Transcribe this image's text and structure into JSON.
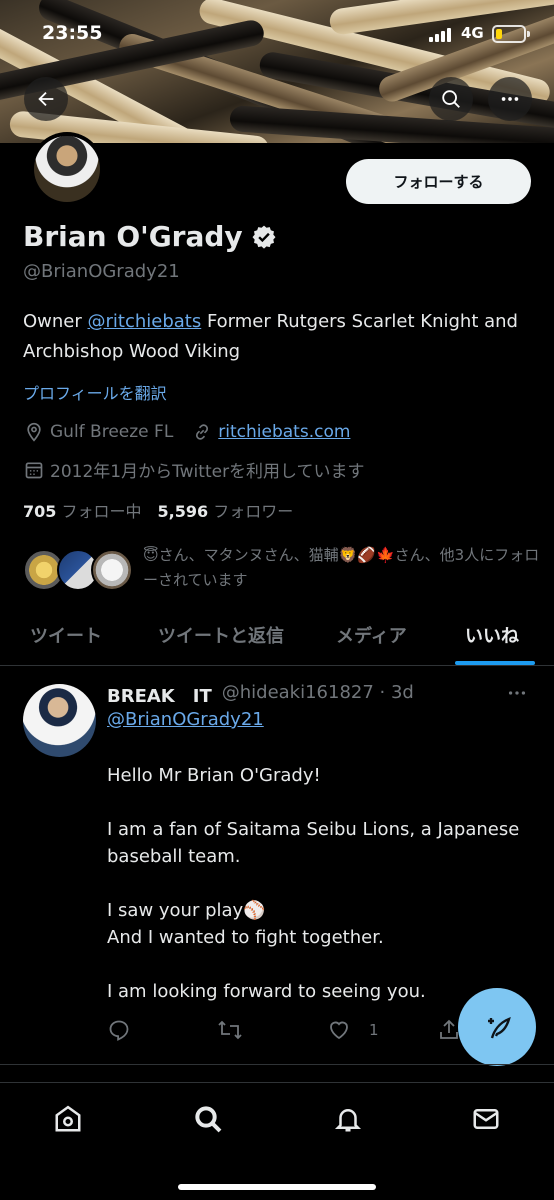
{
  "status_bar": {
    "time": "23:55",
    "network": "4G"
  },
  "header": {
    "back_icon": "arrow-left-icon",
    "search_icon": "search-icon",
    "more_icon": "more-horizontal-icon"
  },
  "profile": {
    "name": "Brian O'Grady",
    "verified": true,
    "handle": "@BrianOGrady21",
    "follow_label": "フォローする",
    "bio_prefix": "Owner ",
    "bio_mention": "@ritchiebats",
    "bio_suffix": " Former Rutgers Scarlet Knight and Archbishop Wood Viking",
    "translate_label": "プロフィールを翻訳",
    "location": "Gulf Breeze FL",
    "website": "ritchiebats.com",
    "joined": "2012年1月からTwitterを利用しています",
    "following_count": "705",
    "following_label": "フォロー中",
    "followers_count": "5,596",
    "followers_label": "フォロワー",
    "followed_by_text": "😇さん、マタンヌさん、猫輔🦁🏈🍁さん、他3人にフォローされています"
  },
  "tabs": [
    {
      "label": "ツイート",
      "active": false
    },
    {
      "label": "ツイートと返信",
      "active": false
    },
    {
      "label": "メディア",
      "active": false
    },
    {
      "label": "いいね",
      "active": true
    }
  ],
  "tweet": {
    "author": "BREAK　IT",
    "handle_time": "@hideaki161827 · 3d",
    "reply_to": "@BrianOGrady21",
    "paragraphs": [
      "Hello Mr Brian O'Grady!",
      "I am a fan of Saitama Seibu Lions, a Japanese baseball team.",
      "I saw your play⚾\nAnd I wanted to fight together.",
      "I am looking forward to seeing you."
    ],
    "like_count": "1"
  },
  "bottom_nav": [
    "home-icon",
    "search-icon",
    "notifications-icon",
    "messages-icon"
  ],
  "colors": {
    "background": "#000000",
    "accent": "#1d9bf0",
    "link": "#6aa9e9",
    "secondary_text": "#71767b",
    "fab": "#7ec6f2"
  }
}
